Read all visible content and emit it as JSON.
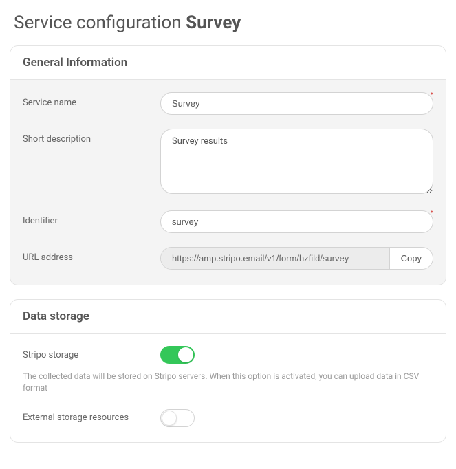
{
  "title": {
    "prefix": "Service configuration ",
    "name": "Survey"
  },
  "general": {
    "header": "General Information",
    "serviceName": {
      "label": "Service name",
      "value": "Survey"
    },
    "shortDescription": {
      "label": "Short description",
      "value": "Survey results"
    },
    "identifier": {
      "label": "Identifier",
      "value": "survey"
    },
    "urlAddress": {
      "label": "URL address",
      "value": "https://amp.stripo.email/v1/form/hzfild/survey",
      "copyLabel": "Copy"
    }
  },
  "storage": {
    "header": "Data storage",
    "stripo": {
      "label": "Stripo storage",
      "hint": "The collected data will be stored on Stripo servers. When this option is activated, you can upload data in CSV format"
    },
    "external": {
      "label": "External storage resources"
    }
  }
}
